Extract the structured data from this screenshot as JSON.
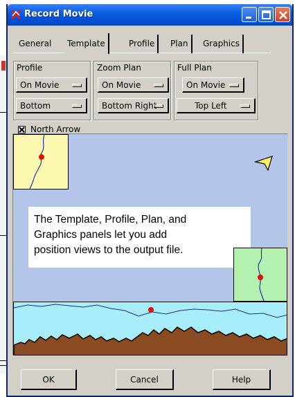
{
  "window": {
    "title": "Record Movie",
    "title_color": "#ffffff",
    "titlebar_color": "#0a5fe3"
  },
  "tabs": [
    {
      "label": "General",
      "active": false
    },
    {
      "label": "Template",
      "active": true
    },
    {
      "label": "Profile",
      "active": false
    },
    {
      "label": "Plan",
      "active": false
    },
    {
      "label": "Graphics",
      "active": false
    }
  ],
  "groups": [
    {
      "label": "Profile",
      "dropdown1": "On Movie",
      "dropdown2": "Bottom"
    },
    {
      "label": "Zoom Plan",
      "dropdown1": "On Movie",
      "dropdown2": "Bottom Right"
    },
    {
      "label": "Full Plan",
      "dropdown1": "On Movie",
      "dropdown2": "Top Left"
    }
  ],
  "north_arrow": {
    "label": "North Arrow",
    "checked": true
  },
  "note": {
    "lines": [
      "The Template, Profile, Plan, and",
      "Graphics panels let you add",
      "position views to the output file."
    ]
  },
  "buttons": {
    "ok": "OK",
    "cancel": "Cancel",
    "help": "Help"
  },
  "colors": {
    "preview_bg": "#b3c5e9",
    "full_plan_bg": "#fcf8b0",
    "zoom_plan_bg": "#b4f0ae",
    "profile_sky": "#a8eefa",
    "terrain": "#8a4a22",
    "marker": "#e01010",
    "north_arrow": "#f5ef6a"
  }
}
